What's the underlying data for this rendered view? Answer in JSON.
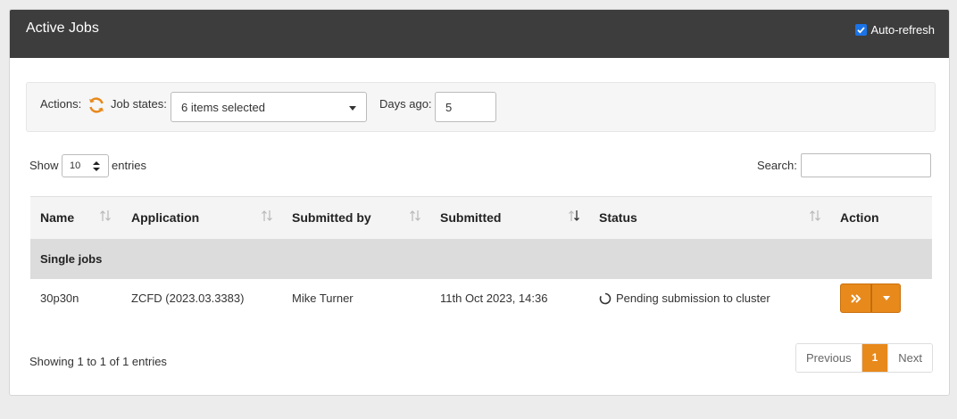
{
  "panel": {
    "title": "Active Jobs",
    "auto_refresh_label": "Auto-refresh",
    "auto_refresh_checked": true
  },
  "filters": {
    "actions_label": "Actions:",
    "job_states_label": "Job states:",
    "job_states_value": "6 items selected",
    "days_ago_label": "Days ago:",
    "days_ago_value": "5"
  },
  "table_controls": {
    "show_label": "Show",
    "page_length": "10",
    "entries_label": "entries",
    "search_label": "Search:",
    "search_value": ""
  },
  "table": {
    "columns": [
      "Name",
      "Application",
      "Submitted by",
      "Submitted",
      "Status",
      "Action"
    ],
    "sorted_column": "Submitted",
    "group_label": "Single jobs",
    "rows": [
      {
        "name": "30p30n",
        "application": "ZCFD (2023.03.3383)",
        "submitted_by": "Mike Turner",
        "submitted": "11th Oct 2023, 14:36",
        "status": "Pending submission to cluster"
      }
    ]
  },
  "footer": {
    "info": "Showing 1 to 1 of 1 entries",
    "previous": "Previous",
    "current_page": "1",
    "next": "Next"
  },
  "colors": {
    "header_bg": "#3d3d3d",
    "accent_orange": "#e8891c",
    "checkbox_blue": "#1a73e8"
  },
  "icons": {
    "refresh": "refresh-icon",
    "sort": "sort-both-icon",
    "status": "pending-spinner-icon",
    "action_main": "double-chevron-right-icon",
    "action_drop": "caret-down-icon"
  }
}
